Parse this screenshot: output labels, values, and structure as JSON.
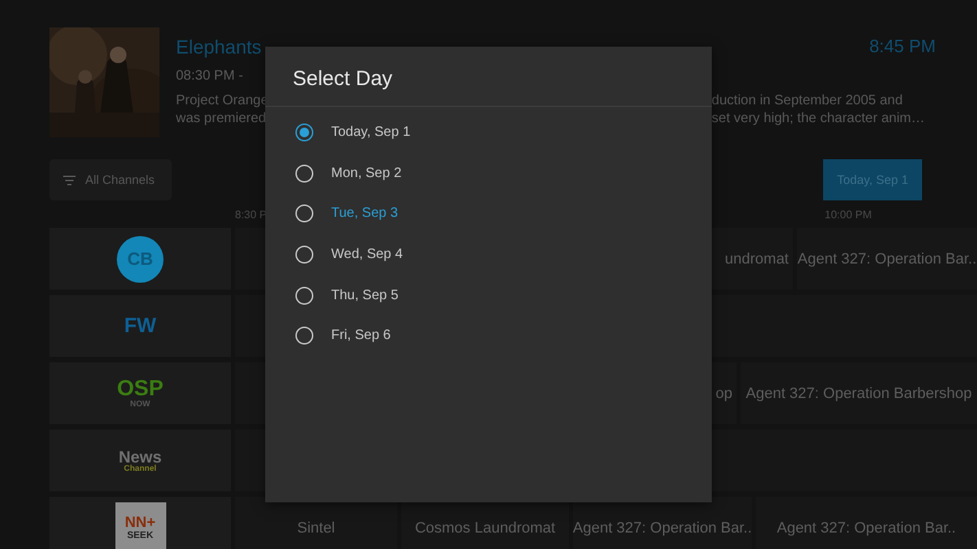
{
  "clock": "8:45 PM",
  "program": {
    "title": "Elephants",
    "time": "08:30 PM -",
    "description_left": [
      "Project Orange",
      "was premiered"
    ],
    "description_right": [
      "duction in September 2005 and",
      "set very high; the character anim…"
    ]
  },
  "filter_button": {
    "label": "All Channels"
  },
  "day_button": {
    "label": "Today, Sep 1"
  },
  "timeline": [
    "8:30 P",
    "10:00 PM"
  ],
  "channels": [
    {
      "logo": {
        "kind": "circle",
        "text": "CB",
        "color": "#1287b8"
      },
      "programs": [
        "undromat",
        "Agent 327: Operation Bar.."
      ]
    },
    {
      "logo": {
        "kind": "word",
        "text": "FW",
        "color": "#0e5f94"
      }
    },
    {
      "logo": {
        "kind": "stacked",
        "text": "OSP",
        "sub": "NOW",
        "color": "#3b7d12"
      },
      "programs": [
        "op",
        "Agent 327: Operation Barbershop"
      ]
    },
    {
      "logo": {
        "kind": "stacked",
        "text": "News",
        "sub": "Channel",
        "color": "#7d7d22"
      }
    },
    {
      "logo": {
        "kind": "tile",
        "text": "NN+",
        "sub": "SEEK",
        "color": "#8a2e0c"
      },
      "programs": [
        "Sintel",
        "Cosmos Laundromat",
        "Agent 327: Operation Bar..",
        "Agent 327: Operation Bar.."
      ]
    }
  ],
  "dialog": {
    "title": "Select Day",
    "options": [
      {
        "label": "Today, Sep 1",
        "selected": true,
        "focused": false
      },
      {
        "label": "Mon, Sep 2",
        "selected": false,
        "focused": false
      },
      {
        "label": "Tue, Sep 3",
        "selected": false,
        "focused": true
      },
      {
        "label": "Wed, Sep 4",
        "selected": false,
        "focused": false
      },
      {
        "label": "Thu, Sep 5",
        "selected": false,
        "focused": false
      },
      {
        "label": "Fri, Sep 6",
        "selected": false,
        "focused": false
      }
    ]
  }
}
